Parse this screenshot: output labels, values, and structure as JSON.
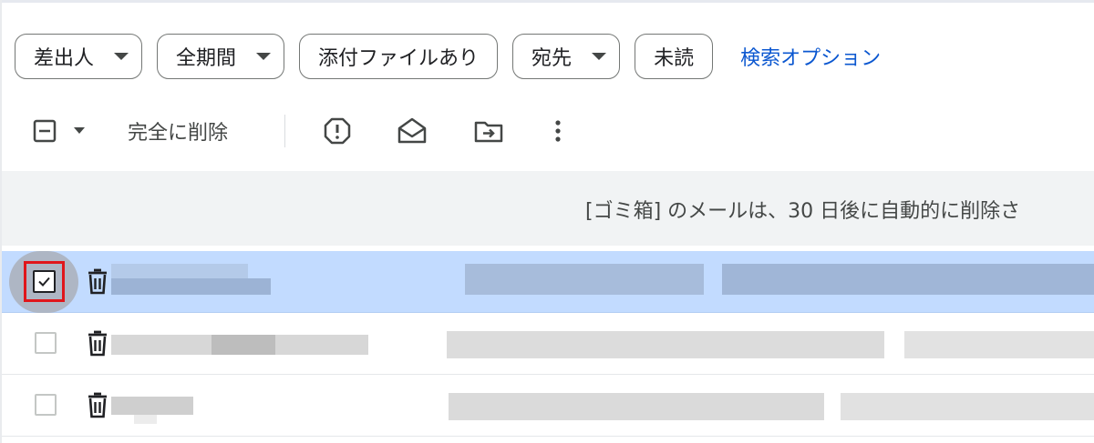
{
  "filters": {
    "sender_label": "差出人",
    "period_label": "全期間",
    "attachment_label": "添付ファイルあり",
    "recipient_label": "宛先",
    "unread_label": "未読",
    "search_options_label": "検索オプション"
  },
  "toolbar": {
    "delete_forever_label": "完全に削除",
    "icons": [
      "select-dropdown-icon",
      "report-spam-icon",
      "mark-as-read-icon",
      "move-to-icon",
      "more-options-icon"
    ]
  },
  "banner": {
    "text": "[ゴミ箱] のメールは、30 日後に自動的に削除さ"
  },
  "rows": [
    {
      "selected": true,
      "checked": true
    },
    {
      "selected": false,
      "checked": false
    },
    {
      "selected": false,
      "checked": false
    }
  ],
  "colors": {
    "accent": "#0b57d0",
    "selected_row": "#c2dbff",
    "banner_bg": "#f1f3f4",
    "highlight": "#e0161b"
  }
}
